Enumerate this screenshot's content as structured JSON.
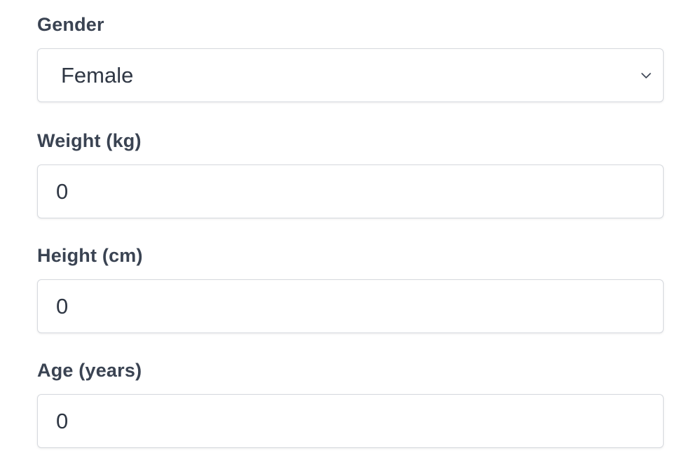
{
  "form": {
    "gender": {
      "label": "Gender",
      "value": "Female",
      "icon": "chevron-down-icon"
    },
    "weight": {
      "label": "Weight (kg)",
      "value": "0"
    },
    "height": {
      "label": "Height (cm)",
      "value": "0"
    },
    "age": {
      "label": "Age (years)",
      "value": "0"
    }
  }
}
